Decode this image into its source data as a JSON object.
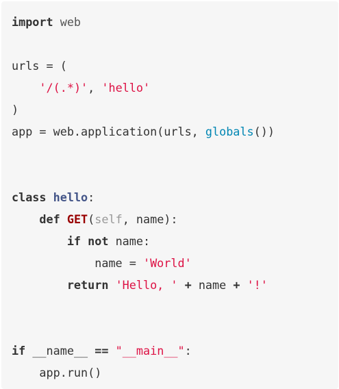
{
  "code": {
    "language": "python",
    "lines": [
      {
        "id": "l1",
        "tokens": [
          [
            "kw",
            "import"
          ],
          [
            "mod",
            " web"
          ]
        ]
      },
      {
        "id": "l2",
        "tokens": [
          [
            "plain",
            "urls = ("
          ]
        ]
      },
      {
        "id": "l3",
        "tokens": [
          [
            "plain",
            "    "
          ],
          [
            "str",
            "'/(.*)'"
          ],
          [
            "plain",
            ", "
          ],
          [
            "str",
            "'hello'"
          ]
        ]
      },
      {
        "id": "l4",
        "tokens": [
          [
            "plain",
            ")"
          ]
        ]
      },
      {
        "id": "l5",
        "tokens": [
          [
            "plain",
            "app = web.application(urls, "
          ],
          [
            "bi",
            "globals"
          ],
          [
            "plain",
            "())"
          ]
        ]
      },
      {
        "id": "l6",
        "tokens": [
          [
            "kw",
            "class"
          ],
          [
            "plain",
            " "
          ],
          [
            "cls",
            "hello"
          ],
          [
            "plain",
            ":"
          ]
        ]
      },
      {
        "id": "l7",
        "tokens": [
          [
            "plain",
            "    "
          ],
          [
            "kw",
            "def"
          ],
          [
            "plain",
            " "
          ],
          [
            "fn",
            "GET"
          ],
          [
            "plain",
            "("
          ],
          [
            "self",
            "self"
          ],
          [
            "plain",
            ", name):"
          ]
        ]
      },
      {
        "id": "l8",
        "tokens": [
          [
            "plain",
            "        "
          ],
          [
            "kw",
            "if"
          ],
          [
            "plain",
            " "
          ],
          [
            "kw",
            "not"
          ],
          [
            "plain",
            " name:"
          ]
        ]
      },
      {
        "id": "l9",
        "tokens": [
          [
            "plain",
            "            name = "
          ],
          [
            "str",
            "'World'"
          ]
        ]
      },
      {
        "id": "l10",
        "tokens": [
          [
            "plain",
            "        "
          ],
          [
            "kw",
            "return"
          ],
          [
            "plain",
            " "
          ],
          [
            "str",
            "'Hello, '"
          ],
          [
            "plain",
            " "
          ],
          [
            "op",
            "+"
          ],
          [
            "plain",
            " name "
          ],
          [
            "op",
            "+"
          ],
          [
            "plain",
            " "
          ],
          [
            "str",
            "'!'"
          ]
        ]
      },
      {
        "id": "l11",
        "tokens": [
          [
            "kw",
            "if"
          ],
          [
            "plain",
            " __name__ "
          ],
          [
            "op",
            "=="
          ],
          [
            "plain",
            " "
          ],
          [
            "str",
            "\"__main__\""
          ],
          [
            "plain",
            ":"
          ]
        ]
      },
      {
        "id": "l12",
        "tokens": [
          [
            "plain",
            "    app.run()"
          ]
        ]
      }
    ]
  },
  "colors": {
    "background": "#f6f6f6",
    "text": "#333333",
    "string": "#dd1144",
    "builtin": "#0086b3",
    "class_name": "#445588",
    "function_name": "#990000",
    "self": "#999999"
  }
}
